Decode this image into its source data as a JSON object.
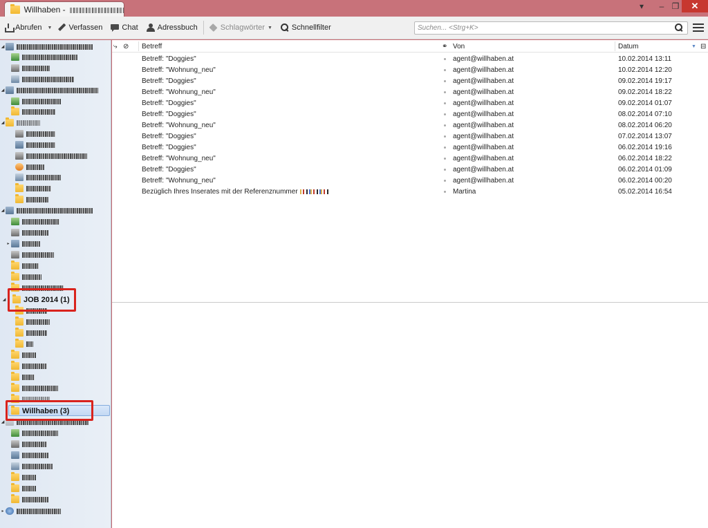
{
  "window": {
    "tab_title": "Willhaben - ",
    "controls": {
      "menu": "▾",
      "minimize": "–",
      "maximize": "❐",
      "close": "✕"
    }
  },
  "toolbar": {
    "get_messages": "Abrufen",
    "compose": "Verfassen",
    "chat": "Chat",
    "address_book": "Adressbuch",
    "tags": "Schlagwörter",
    "quick_filter": "Schnellfilter",
    "search_placeholder": "Suchen... <Strg+K>"
  },
  "folders": {
    "job_folder": "JOB 2014 (1)",
    "selected_folder": "Willhaben (3)"
  },
  "message_list": {
    "columns": {
      "subject": "Betreff",
      "from": "Von",
      "date": "Datum"
    },
    "rows": [
      {
        "subject": "Betreff: \"Doggies\"",
        "from": "agent@willhaben.at",
        "date": "10.02.2014 13:11"
      },
      {
        "subject": "Betreff: \"Wohnung_neu\"",
        "from": "agent@willhaben.at",
        "date": "10.02.2014 12:20"
      },
      {
        "subject": "Betreff: \"Doggies\"",
        "from": "agent@willhaben.at",
        "date": "09.02.2014 19:17"
      },
      {
        "subject": "Betreff: \"Wohnung_neu\"",
        "from": "agent@willhaben.at",
        "date": "09.02.2014 18:22"
      },
      {
        "subject": "Betreff: \"Doggies\"",
        "from": "agent@willhaben.at",
        "date": "09.02.2014 01:07"
      },
      {
        "subject": "Betreff: \"Doggies\"",
        "from": "agent@willhaben.at",
        "date": "08.02.2014 07:10"
      },
      {
        "subject": "Betreff: \"Wohnung_neu\"",
        "from": "agent@willhaben.at",
        "date": "08.02.2014 06:20"
      },
      {
        "subject": "Betreff: \"Doggies\"",
        "from": "agent@willhaben.at",
        "date": "07.02.2014 13:07"
      },
      {
        "subject": "Betreff: \"Doggies\"",
        "from": "agent@willhaben.at",
        "date": "06.02.2014 19:16"
      },
      {
        "subject": "Betreff: \"Wohnung_neu\"",
        "from": "agent@willhaben.at",
        "date": "06.02.2014 18:22"
      },
      {
        "subject": "Betreff: \"Doggies\"",
        "from": "agent@willhaben.at",
        "date": "06.02.2014 01:09"
      },
      {
        "subject": "Betreff: \"Wohnung_neu\"",
        "from": "agent@willhaben.at",
        "date": "06.02.2014 00:20"
      },
      {
        "subject": "Bezüglich Ihres Inserates mit der Referenznummer",
        "from": "Martina",
        "date": "05.02.2014 16:54"
      }
    ]
  },
  "colors": {
    "title_bar": "#c8727a",
    "close_button": "#c7372f",
    "highlight_box": "#d9231d",
    "folder_pane": "#e3ebf5",
    "selection": "#c9dcf4"
  }
}
